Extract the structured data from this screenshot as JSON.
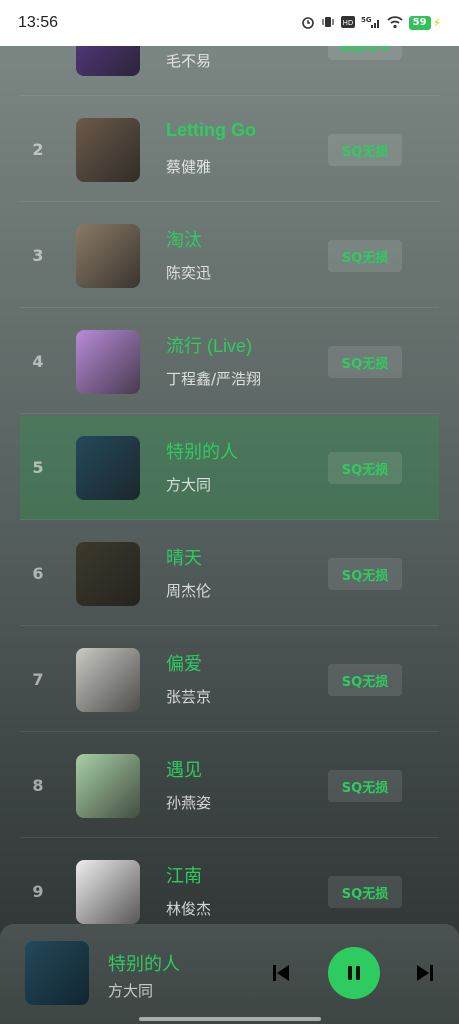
{
  "status_bar": {
    "time": "13:56",
    "icons": [
      "alarm-icon",
      "vibrate-icon",
      "hd-icon",
      "5g-signal-icon",
      "wifi-icon"
    ],
    "battery": "59"
  },
  "songs": [
    {
      "index": "",
      "title": "",
      "artist": "毛不易",
      "badge": "臻品母带",
      "cover_color": "#5a3d8a"
    },
    {
      "index": "2",
      "title": "Letting Go",
      "artist": "蔡健雅",
      "badge": "SQ无损",
      "cover_color": "#6b5a4a"
    },
    {
      "index": "3",
      "title": "淘汰",
      "artist": "陈奕迅",
      "badge": "SQ无损",
      "cover_color": "#8a7a66"
    },
    {
      "index": "4",
      "title": "流行 (Live)",
      "artist": "丁程鑫/严浩翔",
      "badge": "SQ无损",
      "cover_color": "#b98bd8"
    },
    {
      "index": "5",
      "title": "特别的人",
      "artist": "方大同",
      "badge": "SQ无损",
      "cover_color": "#23495c"
    },
    {
      "index": "6",
      "title": "晴天",
      "artist": "周杰伦",
      "badge": "SQ无损",
      "cover_color": "#3d3a2b"
    },
    {
      "index": "7",
      "title": "偏爱",
      "artist": "张芸京",
      "badge": "SQ无损",
      "cover_color": "#c9c9c4"
    },
    {
      "index": "8",
      "title": "遇见",
      "artist": "孙燕姿",
      "badge": "SQ无损",
      "cover_color": "#a8cfa5"
    },
    {
      "index": "9",
      "title": "江南",
      "artist": "林俊杰",
      "badge": "SQ无损",
      "cover_color": "#eeeeee"
    }
  ],
  "active_index": 4,
  "now_playing": {
    "title": "特别的人",
    "artist": "方大同",
    "cover_color": "#23495c"
  },
  "colors": {
    "accent": "#2ecc60"
  }
}
